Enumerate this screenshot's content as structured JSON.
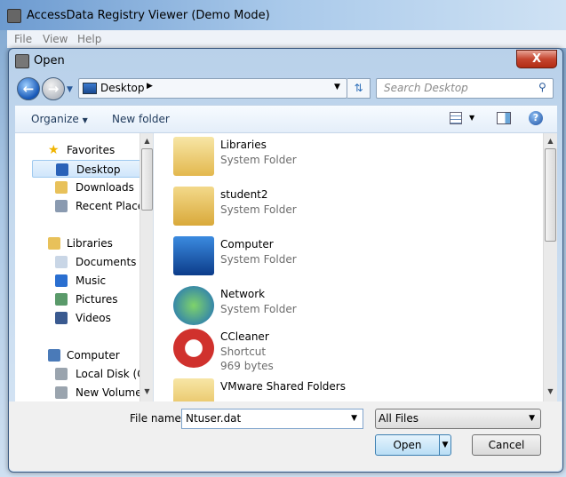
{
  "app": {
    "title": "AccessData Registry Viewer (Demo Mode)",
    "menu": [
      "File",
      "View",
      "Help"
    ]
  },
  "dialog": {
    "title": "Open",
    "close": "X"
  },
  "nav": {
    "location": "Desktop",
    "search_placeholder": "Search Desktop"
  },
  "toolbar": {
    "organize": "Organize",
    "new_folder": "New folder"
  },
  "sidebar": {
    "items": [
      {
        "label": "Favorites",
        "icon": "star-icon",
        "head": true
      },
      {
        "label": "Desktop",
        "icon": "desktop-icon",
        "selected": true
      },
      {
        "label": "Downloads",
        "icon": "downloads-folder-icon"
      },
      {
        "label": "Recent Places",
        "icon": "recent-places-icon"
      },
      {
        "label": "Libraries",
        "icon": "libraries-icon",
        "head": true
      },
      {
        "label": "Documents",
        "icon": "documents-icon"
      },
      {
        "label": "Music",
        "icon": "music-icon"
      },
      {
        "label": "Pictures",
        "icon": "pictures-icon"
      },
      {
        "label": "Videos",
        "icon": "videos-icon"
      },
      {
        "label": "Computer",
        "icon": "computer-icon",
        "head": true
      },
      {
        "label": "Local Disk (C:)",
        "icon": "disk-icon"
      },
      {
        "label": "New Volume (E:)",
        "icon": "disk-icon"
      }
    ]
  },
  "files": [
    {
      "name": "Libraries",
      "type": "System Folder",
      "icon": "libraries-folder-icon"
    },
    {
      "name": "student2",
      "type": "System Folder",
      "icon": "user-folder-icon"
    },
    {
      "name": "Computer",
      "type": "System Folder",
      "icon": "computer-icon"
    },
    {
      "name": "Network",
      "type": "System Folder",
      "icon": "network-icon"
    },
    {
      "name": "CCleaner",
      "type": "Shortcut",
      "size": "969 bytes",
      "icon": "ccleaner-shortcut-icon"
    },
    {
      "name": "VMware Shared Folders",
      "icon": "folder-icon"
    }
  ],
  "bottom": {
    "filename_label": "File name:",
    "filename_value": "Ntuser.dat",
    "filetype": "All Files",
    "open": "Open",
    "cancel": "Cancel"
  }
}
